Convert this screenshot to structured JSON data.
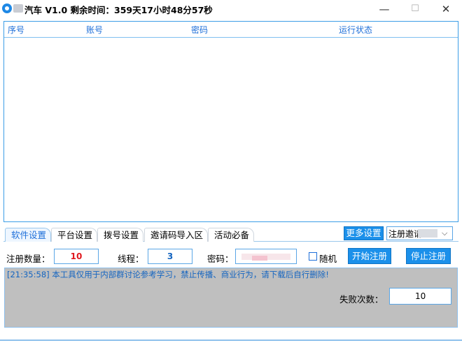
{
  "window": {
    "title": "汽车  V1.0 剩余时间：359天17小时48分57秒",
    "minimize_glyph": "—",
    "maximize_glyph": "☐",
    "close_glyph": "✕"
  },
  "table": {
    "columns": [
      "序号",
      "账号",
      "密码",
      "运行状态"
    ]
  },
  "tabs": [
    {
      "label": "软件设置",
      "active": true
    },
    {
      "label": "平台设置",
      "active": false
    },
    {
      "label": "拨号设置",
      "active": false
    },
    {
      "label": "邀请码导入区",
      "active": false
    },
    {
      "label": "活动必备",
      "active": false
    }
  ],
  "toolbar": {
    "more_settings_label": "更多设置",
    "mode_select_value": "注册邀请",
    "dropdown_glyph": "⌵"
  },
  "settings": {
    "register_count_label": "注册数量：",
    "register_count_value": "10",
    "thread_label": "线程：",
    "thread_value": "3",
    "password_label": "密码：",
    "random_label": "随机",
    "start_label": "开始注册",
    "stop_label": "停止注册"
  },
  "log": {
    "message": "[21:35:58] 本工具仅用于内部群讨论参考学习，禁止传播、商业行为，请下载后自行删除!",
    "fail_count_label": "失败次数：",
    "fail_count_value": "10"
  },
  "colors": {
    "accent": "#1b90ea",
    "header_text": "#1e6fd9",
    "log_text": "#1565c0",
    "number_red": "#e0181e",
    "log_background": "#bfbfbf"
  }
}
